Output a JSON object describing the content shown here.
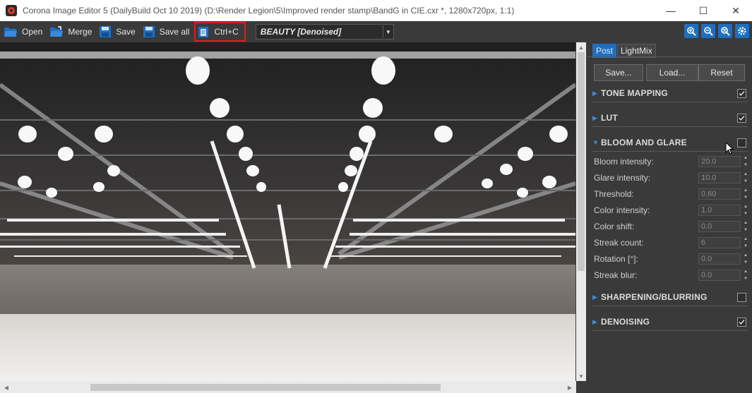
{
  "window": {
    "title": "Corona Image Editor 5 (DailyBuild Oct 10 2019) (D:\\Render Legion\\5\\Improved render stamp\\BandG in CIE.cxr *, 1280x720px, 1:1)",
    "minimize": "—",
    "maximize": "☐",
    "close": "✕"
  },
  "toolbar": {
    "open": "Open",
    "merge": "Merge",
    "save": "Save",
    "save_all": "Save all",
    "copy": "Ctrl+C",
    "pass_value": "BEAUTY [Denoised]"
  },
  "panel": {
    "tabs": [
      "Post",
      "LightMix"
    ],
    "buttons": {
      "save": "Save...",
      "load": "Load...",
      "reset": "Reset"
    },
    "sections": {
      "tone_mapping": {
        "label": "TONE MAPPING",
        "checked": true
      },
      "lut": {
        "label": "LUT",
        "checked": true
      },
      "bloom": {
        "label": "BLOOM AND GLARE",
        "checked": false
      },
      "sharpening": {
        "label": "SHARPENING/BLURRING",
        "checked": false
      },
      "denoising": {
        "label": "DENOISING",
        "checked": true
      }
    },
    "bloom_params": [
      {
        "label": "Bloom intensity:",
        "value": "20.0"
      },
      {
        "label": "Glare intensity:",
        "value": "10.0"
      },
      {
        "label": "Threshold:",
        "value": "0.60"
      },
      {
        "label": "Color intensity:",
        "value": "1.0"
      },
      {
        "label": "Color shift:",
        "value": "0.0"
      },
      {
        "label": "Streak count:",
        "value": "6"
      },
      {
        "label": "Rotation [°]:",
        "value": "0.0"
      },
      {
        "label": "Streak blur:",
        "value": "0.0"
      }
    ]
  },
  "colors": {
    "accent": "#1f6fc0",
    "highlight": "#e01d1d",
    "panel_bg": "#3a3a3a"
  }
}
